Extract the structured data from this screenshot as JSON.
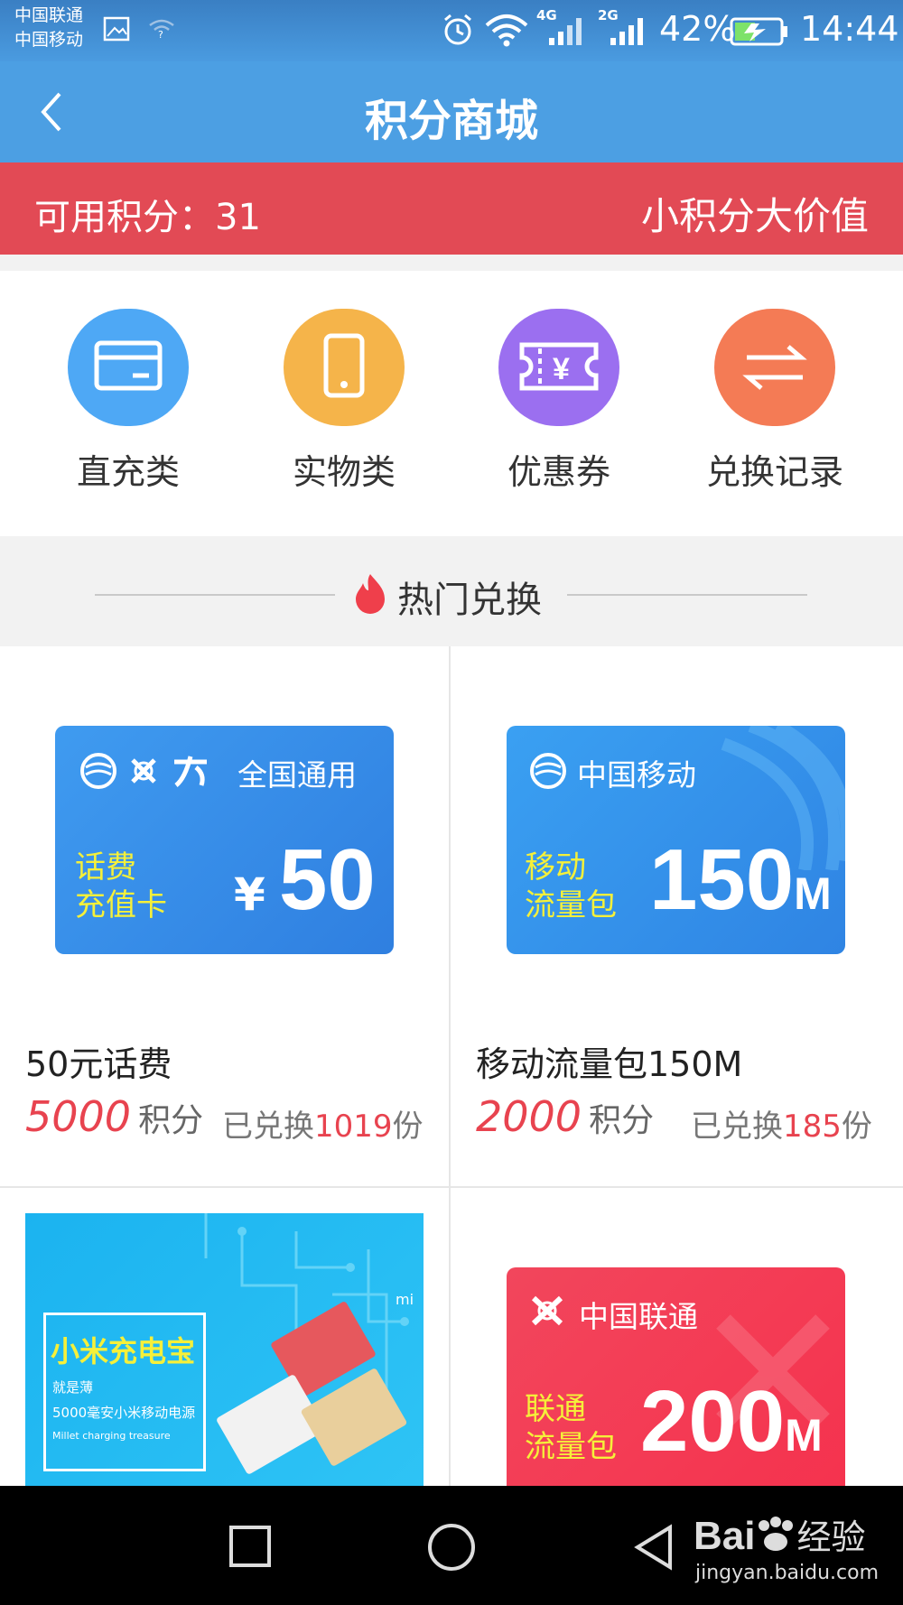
{
  "status_bar": {
    "carrier_1": "中国联通",
    "carrier_2": "中国移动",
    "net_1": "4G",
    "net_2": "2G",
    "battery": "42%",
    "time": "14:44"
  },
  "header": {
    "title": "积分商城"
  },
  "points_bar": {
    "label": "可用积分：31",
    "slogan": "小积分大价值"
  },
  "categories": [
    {
      "label": "直充类",
      "icon": "card-icon",
      "color": "#4ea8f5"
    },
    {
      "label": "实物类",
      "icon": "phone-icon",
      "color": "#f5b44a"
    },
    {
      "label": "优惠券",
      "icon": "coupon-icon",
      "color": "#9b6ff0"
    },
    {
      "label": "兑换记录",
      "icon": "exchange-icon",
      "color": "#f47b55"
    }
  ],
  "hot_section": {
    "title": "热门兑换"
  },
  "products": [
    {
      "name": "50元话费",
      "points": "5000",
      "unit": "积分",
      "exchanged_prefix": "已兑换",
      "exchanged": "1019",
      "exchanged_suffix": "份",
      "card": {
        "brand_text": "全国通用",
        "type_line1": "话费",
        "type_line2": "充值卡",
        "currency": "¥",
        "value": "50",
        "value_suffix": ""
      }
    },
    {
      "name": "移动流量包150M",
      "points": "2000",
      "unit": "积分",
      "exchanged_prefix": "已兑换",
      "exchanged": "185",
      "exchanged_suffix": "份",
      "card": {
        "brand_text": "中国移动",
        "type_line1": "移动",
        "type_line2": "流量包",
        "currency": "",
        "value": "150",
        "value_suffix": "M"
      }
    },
    {
      "card": {
        "brand_text": "小米充电宝",
        "subtitle": "就是薄",
        "line2": "5000毫安小米移动电源",
        "line3": "Millet charging treasure",
        "mark": "mi"
      }
    },
    {
      "card": {
        "brand_text": "中国联通",
        "type_line1": "联通",
        "type_line2": "流量包",
        "value": "200",
        "value_suffix": "M"
      }
    }
  ],
  "watermark": {
    "brand": "Bai",
    "brand2": "经验",
    "url": "jingyan.baidu.com"
  },
  "colors": {
    "header": "#4c9fe3",
    "points_bar": "#e24a55",
    "price": "#e8434f",
    "yellow_text": "#f5f03a"
  }
}
